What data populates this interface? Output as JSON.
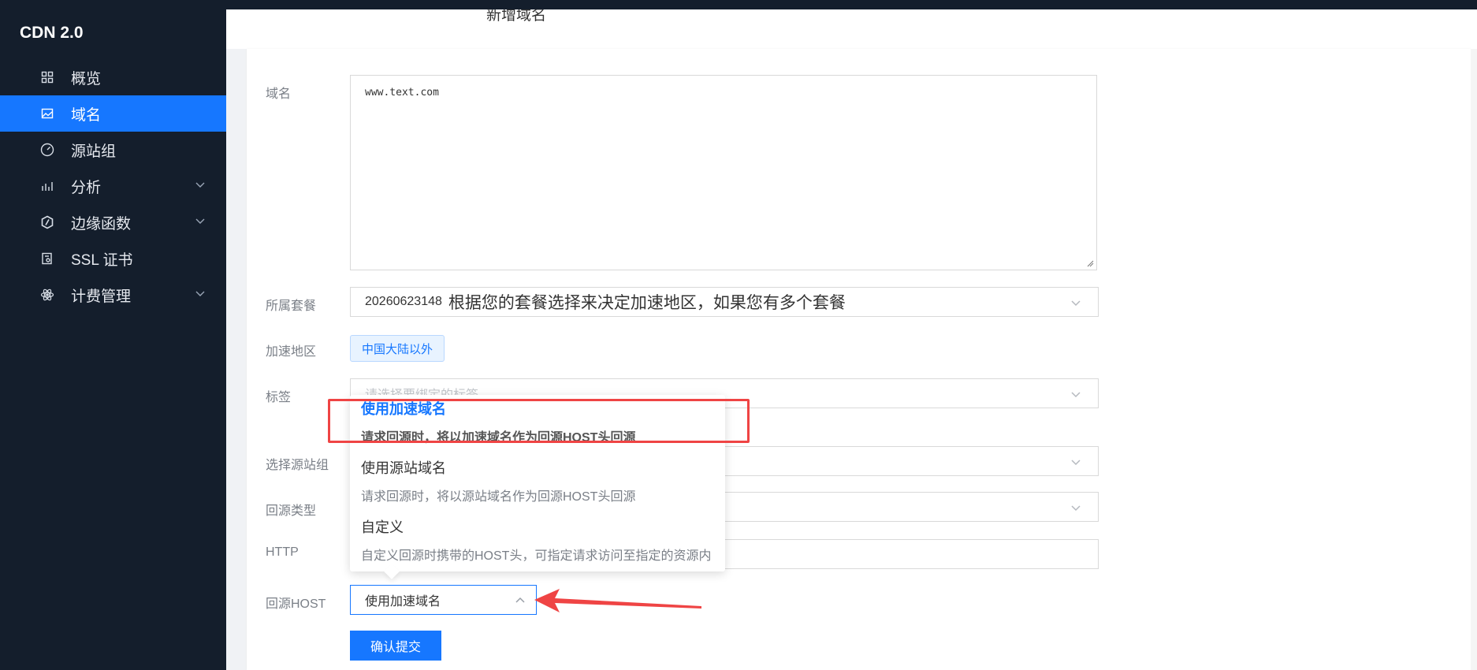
{
  "app": {
    "brand": "CDN 2.0",
    "page_title": "新增域名"
  },
  "sidebar": {
    "items": [
      {
        "label": "概览",
        "icon": "grid-icon",
        "active": false,
        "expandable": false
      },
      {
        "label": "域名",
        "icon": "image-icon",
        "active": true,
        "expandable": false
      },
      {
        "label": "源站组",
        "icon": "gauge-icon",
        "active": false,
        "expandable": false
      },
      {
        "label": "分析",
        "icon": "chart-icon",
        "active": false,
        "expandable": true
      },
      {
        "label": "边缘函数",
        "icon": "hexagon-icon",
        "active": false,
        "expandable": true
      },
      {
        "label": "SSL 证书",
        "icon": "certificate-icon",
        "active": false,
        "expandable": false
      },
      {
        "label": "计费管理",
        "icon": "atom-icon",
        "active": false,
        "expandable": true
      }
    ]
  },
  "form": {
    "domain": {
      "label": "域名",
      "value": "www.text.com"
    },
    "package": {
      "label": "所属套餐",
      "value": "20260623148",
      "hint": "根据您的套餐选择来决定加速地区，如果您有多个套餐"
    },
    "region": {
      "label": "加速地区",
      "tag": "中国大陆以外"
    },
    "tags": {
      "label": "标签",
      "placeholder": "请选择要绑定的标签"
    },
    "origin_group": {
      "label": "选择源站组"
    },
    "origin_type": {
      "label": "回源类型"
    },
    "http": {
      "label": "HTTP"
    },
    "origin_host": {
      "label": "回源HOST",
      "value": "使用加速域名"
    },
    "submit_label": "确认提交"
  },
  "dropdown": {
    "options": [
      {
        "title": "使用加速域名",
        "desc": "请求回源时，将以加速域名作为回源HOST头回源",
        "selected": true
      },
      {
        "title": "使用源站域名",
        "desc": "请求回源时，将以源站域名作为回源HOST头回源",
        "selected": false
      },
      {
        "title": "自定义",
        "desc": "自定义回源时携带的HOST头，可指定请求访问至指定的资源内",
        "selected": false
      }
    ]
  },
  "colors": {
    "primary": "#1677ff",
    "sidebar_bg": "#141e2c",
    "annotation": "#ef4444"
  }
}
